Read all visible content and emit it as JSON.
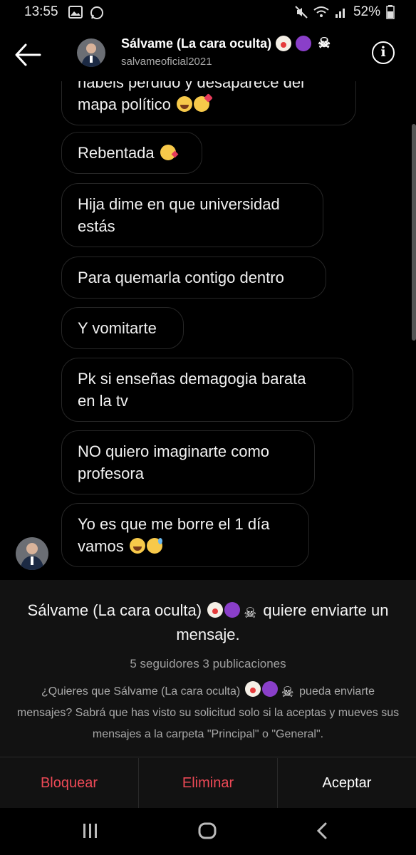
{
  "status_bar": {
    "time": "13:55",
    "battery": "52%"
  },
  "header": {
    "title": "Sálvame (La cara oculta)",
    "username": "salvameoficial2021",
    "title_emojis": [
      "clown-face-icon",
      "smiling-devil-icon",
      "skull-crossbones-icon"
    ]
  },
  "messages": [
    {
      "line1": "habéis perdido y desaparece del",
      "line2": "mapa político",
      "emojis": [
        "laugh",
        "love"
      ]
    },
    {
      "line1": "Rebentada",
      "line2": "",
      "emojis": [
        "kiss"
      ]
    },
    {
      "line1": "Hija dime en que universidad",
      "line2": "estás",
      "emojis": []
    },
    {
      "line1": "Para quemarla contigo dentro",
      "line2": "",
      "emojis": []
    },
    {
      "line1": "Y vomitarte",
      "line2": "",
      "emojis": []
    },
    {
      "line1": "Pk si enseñas demagogia barata",
      "line2": "en la tv",
      "emojis": []
    },
    {
      "line1": "NO quiero imaginarte como",
      "line2": "profesora",
      "emojis": []
    },
    {
      "line1": "Yo es que me borre el 1 día",
      "line2": "vamos",
      "emojis": [
        "laugh",
        "sweat"
      ]
    }
  ],
  "request": {
    "sender_name": "Sálvame (La cara oculta)",
    "title_suffix": "quiere enviarte un mensaje.",
    "stats": "5 seguidores 3 publicaciones",
    "question_prefix": "¿Quieres que Sálvame (La cara oculta)",
    "question_suffix": "pueda enviarte mensajes? Sabrá que has visto su solicitud solo si la aceptas y mueves sus mensajes a la carpeta \"Principal\" o \"General\"."
  },
  "actions": {
    "block": "Bloquear",
    "delete": "Eliminar",
    "accept": "Aceptar"
  },
  "colors": {
    "danger": "#ed4956",
    "bubble_border": "#262626",
    "panel_bg": "#121212"
  }
}
